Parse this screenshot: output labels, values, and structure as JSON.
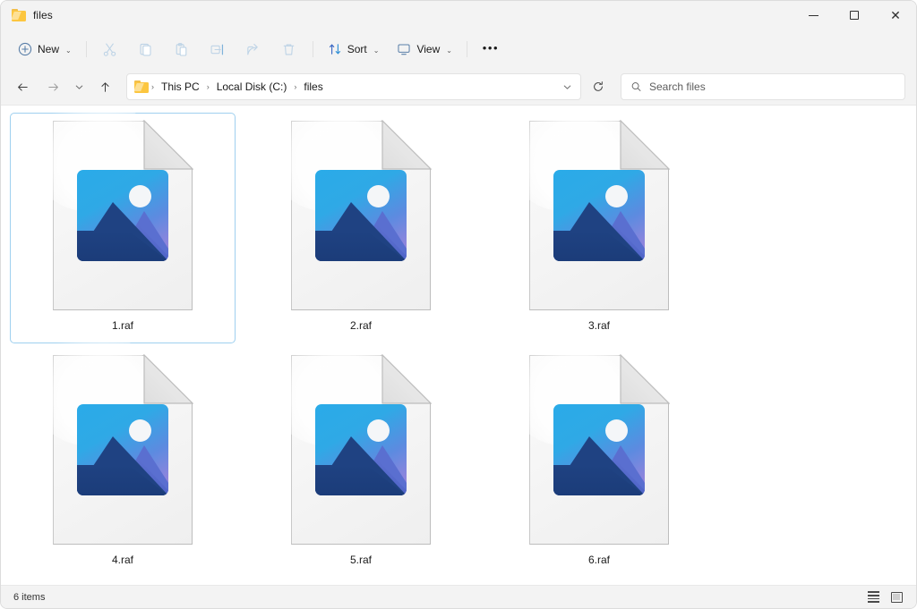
{
  "window": {
    "title": "files",
    "folder_icon": "folder-icon",
    "controls": {
      "minimize": "minimize-button",
      "maximize": "maximize-button",
      "close": "close-button",
      "close_glyph": "✕"
    }
  },
  "toolbar": {
    "new_label": "New",
    "new_icon": "plus-circle-icon",
    "cut_icon": "cut-icon",
    "copy_icon": "copy-icon",
    "paste_icon": "paste-icon",
    "rename_icon": "rename-icon",
    "share_icon": "share-icon",
    "delete_icon": "delete-icon",
    "sort_label": "Sort",
    "sort_icon": "sort-arrows-icon",
    "view_label": "View",
    "view_icon": "monitor-icon",
    "overflow_label": "•••",
    "chevron": "⌄"
  },
  "navigation": {
    "back_icon": "back-arrow-icon",
    "forward_icon": "forward-arrow-icon",
    "recent_icon": "chevron-down-icon",
    "up_icon": "up-arrow-icon",
    "refresh_icon": "refresh-icon",
    "dropdown_icon": "chevron-down-icon"
  },
  "breadcrumb": {
    "separator": "›",
    "items": [
      {
        "label": "This PC"
      },
      {
        "label": "Local Disk (C:)"
      },
      {
        "label": "files"
      }
    ]
  },
  "search": {
    "placeholder": "Search files",
    "value": "",
    "icon": "search-icon"
  },
  "files": [
    {
      "name": "1.raf",
      "selected": true
    },
    {
      "name": "2.raf",
      "selected": false
    },
    {
      "name": "3.raf",
      "selected": false
    },
    {
      "name": "4.raf",
      "selected": false
    },
    {
      "name": "5.raf",
      "selected": false
    },
    {
      "name": "6.raf",
      "selected": false
    }
  ],
  "statusbar": {
    "item_count": "6 items",
    "list_view_icon": "list-view-icon",
    "grid_view_icon": "large-icons-view-icon"
  },
  "colors": {
    "selection_border": "#9fd0ef",
    "accent_blue": "#2aabe8",
    "mountain_dark": "#1f4282",
    "mountain_light": "#5a6fd0",
    "folder_yellow": "#fcc63f",
    "window_chrome": "#f3f3f3"
  }
}
